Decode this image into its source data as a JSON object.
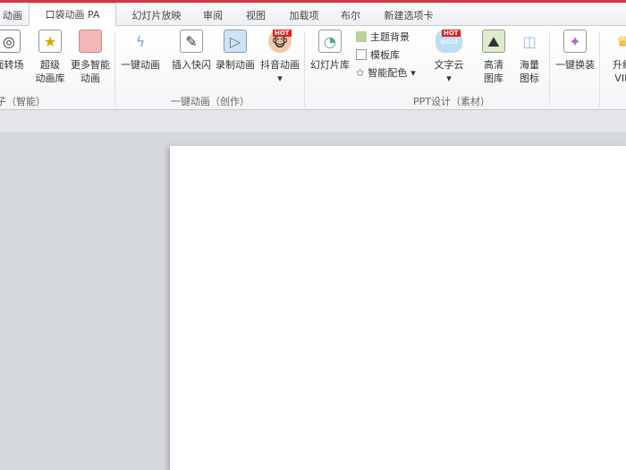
{
  "tabs": [
    "动画",
    "口袋动画 PA",
    "幻灯片放映",
    "审阅",
    "视图",
    "加载项",
    "布尔",
    "新建选项卡"
  ],
  "groups": {
    "smart": {
      "buttons": [
        "面转场",
        "超级\n动画库",
        "更多智能\n动画"
      ],
      "label": "子（智能）"
    },
    "create": {
      "buttons": [
        "一键动画",
        "插入快闪",
        "录制动画",
        "抖音动画"
      ],
      "label": "一键动画（创作）"
    },
    "design": {
      "slide_lib": "幻灯片库",
      "small": [
        "主题背景",
        "模板库",
        "智能配色"
      ],
      "wordcloud": "文字云",
      "hd": "高清\n图库",
      "icons": "海量\n图标",
      "label": "PPT设计（素材）"
    },
    "change": "一键换装",
    "vip": "升级\nVIP",
    "hot": "HOT",
    "dropdown": "▾"
  }
}
